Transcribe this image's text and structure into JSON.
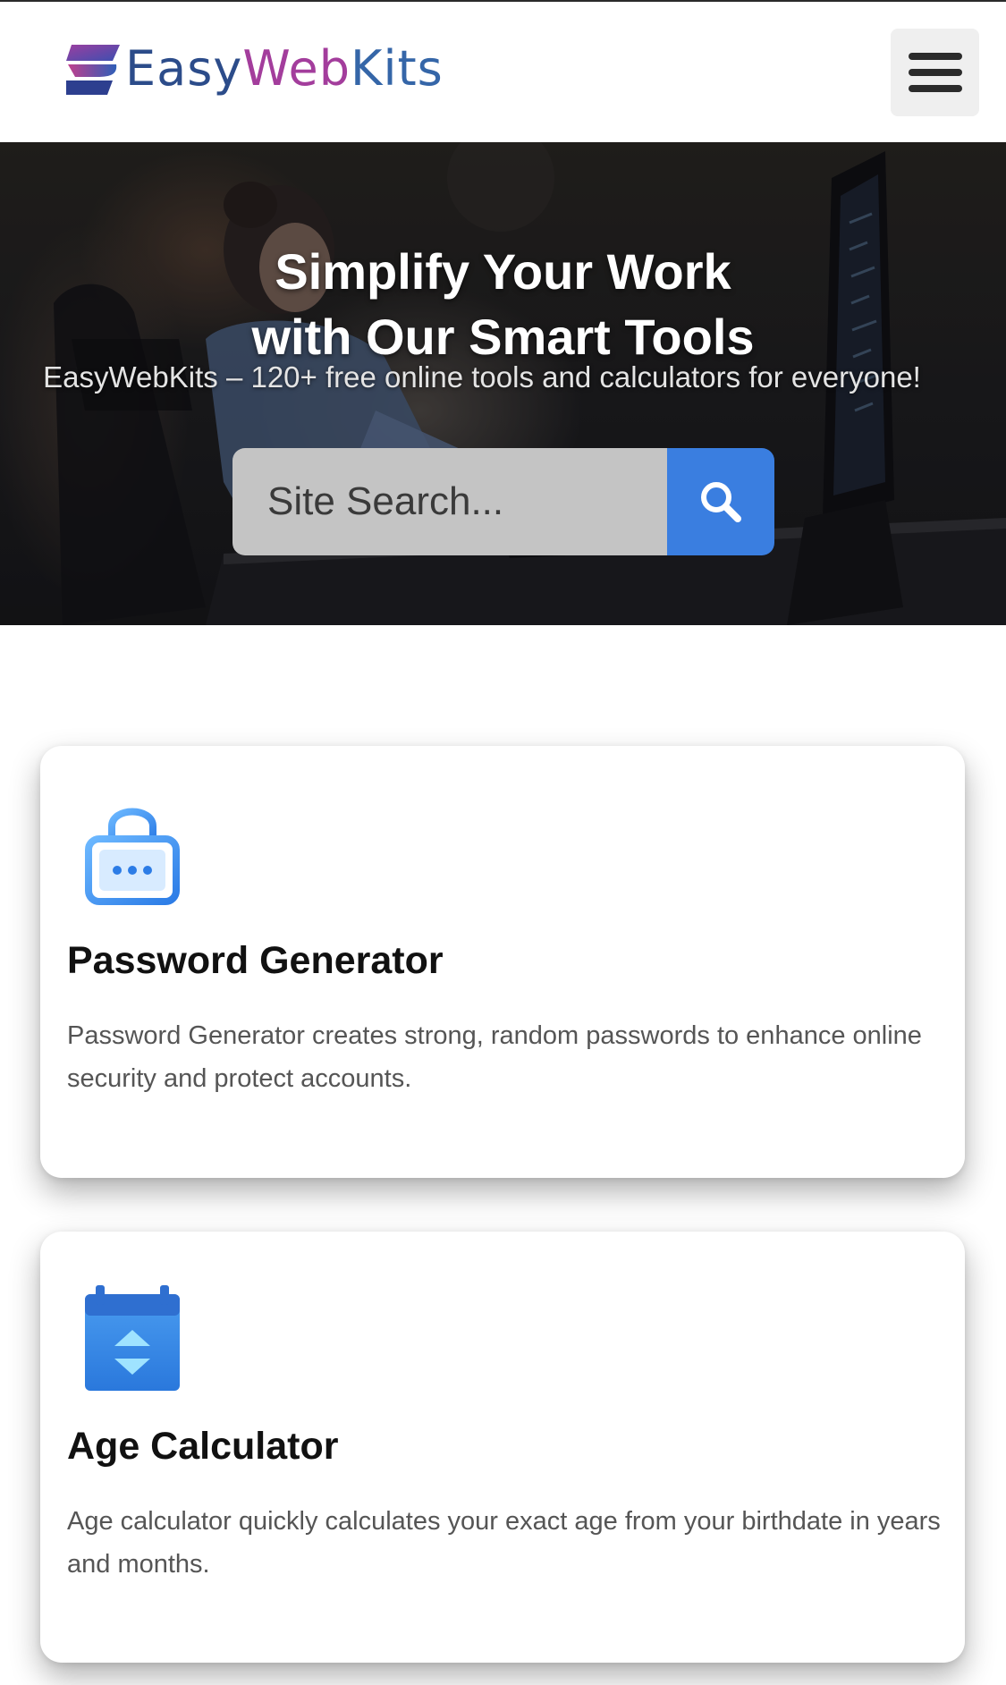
{
  "header": {
    "logo": {
      "part_easy": "Easy",
      "part_web": "Web",
      "part_kits": "Kits"
    },
    "menu_icon": "hamburger-menu-icon"
  },
  "hero": {
    "title_line1": "Simplify Your Work",
    "title_line2": "with Our Smart Tools",
    "subtitle": "EasyWebKits – 120+ free online tools and calculators for everyone!",
    "search": {
      "placeholder": "Site Search...",
      "value": "",
      "button_icon": "search-icon"
    }
  },
  "tools": [
    {
      "icon": "lock-icon",
      "title": "Password Generator",
      "description": "Password Generator creates strong, random passwords to enhance online security and protect accounts."
    },
    {
      "icon": "calendar-icon",
      "title": "Age Calculator",
      "description": "Age calculator quickly calculates your exact age from your birthdate in years and months."
    }
  ],
  "colors": {
    "accent_blue": "#3a7ee0",
    "logo_navy": "#2c4c8a",
    "logo_magenta": "#a33d9c",
    "menu_bg": "#efefef",
    "search_bg": "#c4c4c4"
  }
}
